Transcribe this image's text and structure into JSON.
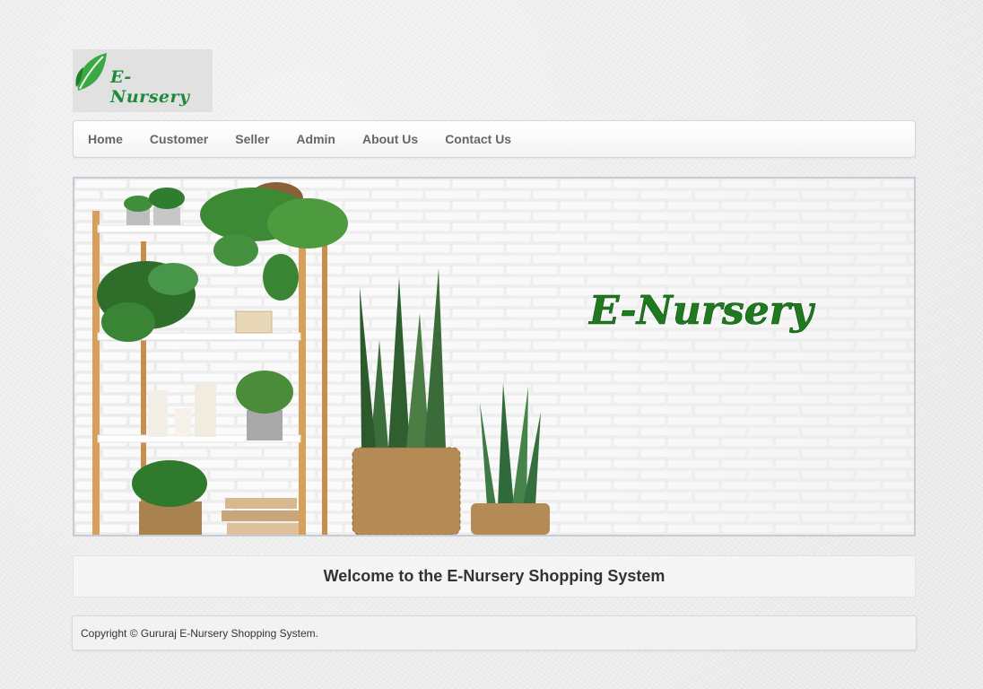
{
  "logo": {
    "text": "E- Nursery",
    "leaf_color": "#2e9e3e"
  },
  "nav": {
    "items": [
      {
        "label": "Home"
      },
      {
        "label": "Customer"
      },
      {
        "label": "Seller"
      },
      {
        "label": "Admin"
      },
      {
        "label": "About Us"
      },
      {
        "label": "Contact Us"
      }
    ]
  },
  "banner": {
    "title": "E-Nursery",
    "title_color": "#1f7a1f"
  },
  "welcome": {
    "text": "Welcome to the E-Nursery Shopping System"
  },
  "footer": {
    "copyright": "Copyright © Gururaj E-Nursery Shopping System."
  }
}
